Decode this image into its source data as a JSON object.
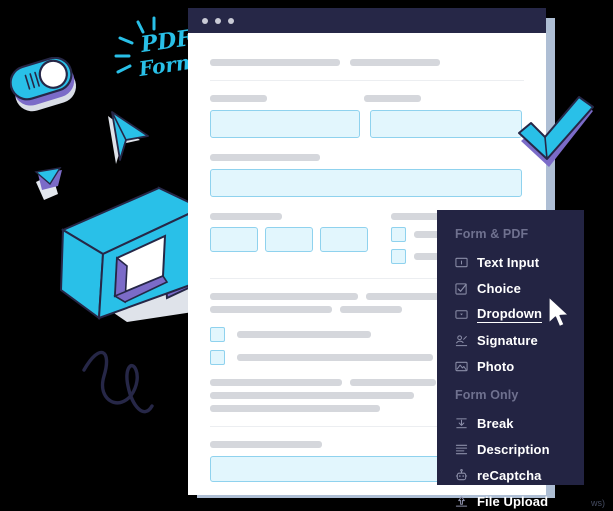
{
  "window": {
    "titlebar_dots": 3
  },
  "document": {
    "header_bars": [
      130,
      90
    ],
    "section_one": {
      "labels": [
        "label-left",
        "label-right"
      ],
      "fields": [
        "field-left",
        "field-right"
      ]
    },
    "wide_field_label": "wide-label",
    "triple_row": {
      "label_left": "triple-label",
      "label_right": "checkbox-group-label",
      "fields": 3,
      "checkboxes": 2
    },
    "paragraph_lines": 2,
    "checkbox_list": 2,
    "paragraph_block_lines": 3,
    "footer_label": "footer-label",
    "footer_field": "footer-field"
  },
  "menu": {
    "groups": [
      {
        "title": "Form & PDF",
        "items": [
          {
            "label": "Text Input",
            "icon": "text-input-icon",
            "active": false
          },
          {
            "label": "Choice",
            "icon": "choice-icon",
            "active": false
          },
          {
            "label": "Dropdown",
            "icon": "dropdown-icon",
            "active": true
          },
          {
            "label": "Signature",
            "icon": "signature-icon",
            "active": false
          },
          {
            "label": "Photo",
            "icon": "photo-icon",
            "active": false
          }
        ]
      },
      {
        "title": "Form Only",
        "items": [
          {
            "label": "Break",
            "icon": "break-icon",
            "active": false
          },
          {
            "label": "Description",
            "icon": "description-icon",
            "active": false
          },
          {
            "label": "reCaptcha",
            "icon": "recaptcha-icon",
            "active": false
          },
          {
            "label": "File Upload",
            "icon": "file-upload-icon",
            "active": false
          }
        ]
      }
    ]
  },
  "decorations": {
    "handwritten_text": [
      "PDF",
      "Form"
    ],
    "items": [
      "toggle-switch",
      "paper-plane-cursor",
      "isometric-cube",
      "checkmark",
      "signature-squiggle",
      "small-fold"
    ]
  },
  "watermark": "ws)",
  "colors": {
    "background": "#000000",
    "menu_bg": "#232443",
    "titlebar": "#262747",
    "accent_cyan": "#29c0e8",
    "accent_purple": "#6f5fc0",
    "field_fill": "#e2f6fd",
    "field_border": "#8fd2ee",
    "bar_gray": "#d5d7dc",
    "muted_label": "#6f718f"
  }
}
